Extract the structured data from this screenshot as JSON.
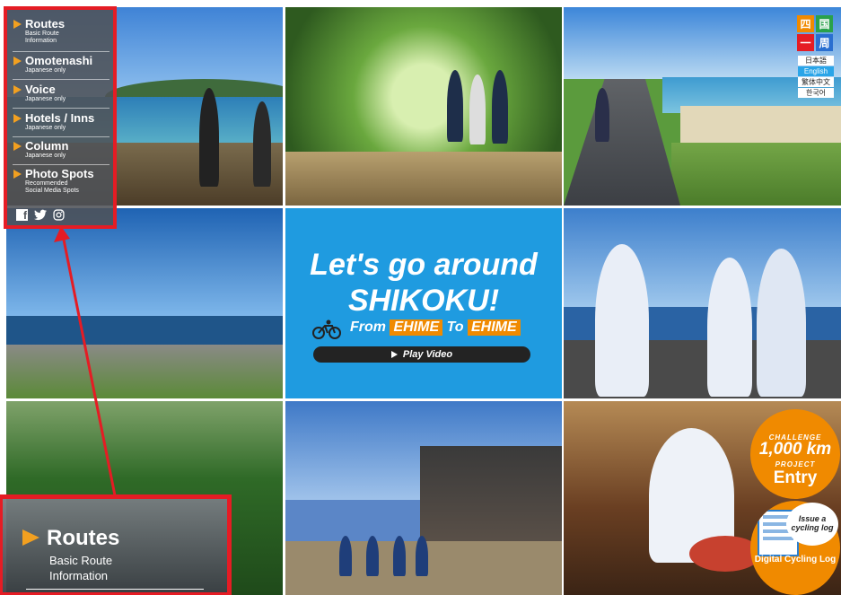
{
  "menu": {
    "items": [
      {
        "title": "Routes",
        "sub": "Basic Route\nInformation"
      },
      {
        "title": "Omotenashi",
        "sub": "Japanese only"
      },
      {
        "title": "Voice",
        "sub": "Japanese only"
      },
      {
        "title": "Hotels / Inns",
        "sub": "Japanese only"
      },
      {
        "title": "Column",
        "sub": "Japanese only"
      },
      {
        "title": "Photo Spots",
        "sub": "Recommended\nSocial Media Spots"
      }
    ],
    "social": [
      "facebook-icon",
      "twitter-icon",
      "instagram-icon"
    ]
  },
  "video": {
    "line1": "Let's go around",
    "line2": "SHIKOKU!",
    "from": "From",
    "ehime1": "EHIME",
    "to": "To",
    "ehime2": "EHIME",
    "play_label": "Play Video"
  },
  "logo": [
    "四",
    "国",
    "一",
    "周"
  ],
  "languages": [
    {
      "label": "日本語",
      "active": false
    },
    {
      "label": "English",
      "active": true
    },
    {
      "label": "繁体中文",
      "active": false
    },
    {
      "label": "한국어",
      "active": false
    }
  ],
  "challenge": {
    "line1": "CHALLENGE",
    "km": "1,000 km",
    "line2": "PROJECT",
    "entry": "Entry"
  },
  "cycling_log": {
    "issue": "Issue a cycling log",
    "label": "Digital Cycling Log"
  },
  "callout": {
    "title": "Routes",
    "sub1": "Basic Route",
    "sub2": "Information"
  },
  "colors": {
    "accent": "#f08a00",
    "highlight": "#e51c24",
    "video_bg": "#1f9be0"
  }
}
